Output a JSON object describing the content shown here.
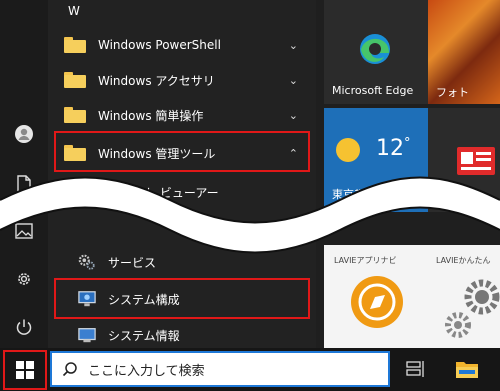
{
  "letter_header": "W",
  "list": {
    "items": [
      {
        "label": "Windows PowerShell",
        "chevron": "⌄"
      },
      {
        "label": "Windows アクセサリ",
        "chevron": "⌄"
      },
      {
        "label": "Windows 簡単操作",
        "chevron": "⌄"
      },
      {
        "label": "Windows 管理ツール",
        "chevron": "⌃"
      }
    ],
    "sub_items": [
      {
        "label": "イベント ビューアー"
      },
      {
        "label": "サービス"
      },
      {
        "label": "システム構成"
      },
      {
        "label": "システム情報"
      }
    ]
  },
  "tiles": {
    "edge": {
      "label": "Microsoft Edge"
    },
    "photos": {
      "label": "フォト"
    },
    "weather": {
      "temp": "12",
      "unit": "°",
      "city": "東京都"
    },
    "lavie_app": {
      "label": "LAVIEアプリナビ"
    },
    "lavie_kantan": {
      "label": "LAVIEかんたん"
    }
  },
  "search": {
    "placeholder": "ここに入力して検索"
  },
  "colors": {
    "highlight": "#e01818",
    "weather_tile": "#1e6fb8",
    "accent": "#1e78d7",
    "lavie_orange": "#f09a13"
  }
}
